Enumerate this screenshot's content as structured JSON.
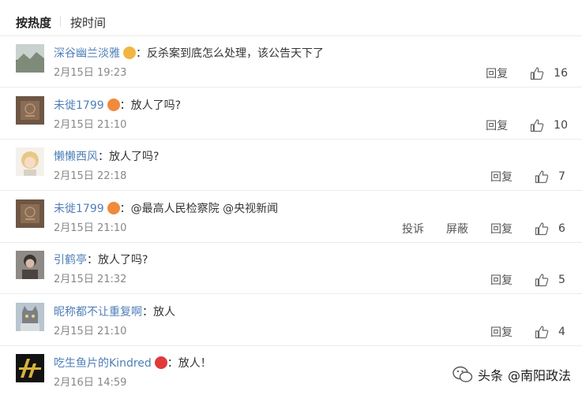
{
  "sort": {
    "hot": "按热度",
    "time": "按时间"
  },
  "comments": [
    {
      "user": "深谷幽兰淡雅",
      "sep": "：",
      "text": "反杀案到底怎么处理，该公告天下了",
      "time": "2月15日 19:23",
      "actions": [
        "回复"
      ],
      "likes": "16",
      "badge_color": "#f2b544",
      "avatar": "avatar-landscape"
    },
    {
      "user": "未徙1799",
      "sep": "：",
      "text": "放人了吗?",
      "time": "2月15日 21:10",
      "actions": [
        "回复"
      ],
      "likes": "10",
      "badge_color": "#f08a3c",
      "avatar": "avatar-brown"
    },
    {
      "user": "懒懒西风",
      "sep": "：",
      "text": "放人了吗?",
      "time": "2月15日 22:18",
      "actions": [
        "回复"
      ],
      "likes": "7",
      "badge_color": "",
      "avatar": "avatar-blonde"
    },
    {
      "user": "未徙1799",
      "sep": "：",
      "text": "@最高人民检察院 @央视新闻",
      "time": "2月15日 21:10",
      "actions": [
        "投诉",
        "屏蔽",
        "回复"
      ],
      "likes": "6",
      "badge_color": "#f08a3c",
      "avatar": "avatar-brown"
    },
    {
      "user": "引鹤亭",
      "sep": "：",
      "text": "放人了吗?",
      "time": "2月15日 21:32",
      "actions": [
        "回复"
      ],
      "likes": "5",
      "badge_color": "",
      "avatar": "avatar-dark"
    },
    {
      "user": "昵称都不让重复啊",
      "sep": "：",
      "text": "放人",
      "time": "2月15日 21:10",
      "actions": [
        "回复"
      ],
      "likes": "4",
      "badge_color": "",
      "avatar": "avatar-cat"
    },
    {
      "user": "吃生鱼片的Kindred",
      "sep": "：",
      "text": "放人！",
      "time": "2月16日 14:59",
      "actions": [],
      "likes": "",
      "badge_color": "#e03a3a",
      "avatar": "avatar-gold"
    }
  ],
  "watermark": {
    "text": "头条",
    "at": "@南阳政法"
  }
}
